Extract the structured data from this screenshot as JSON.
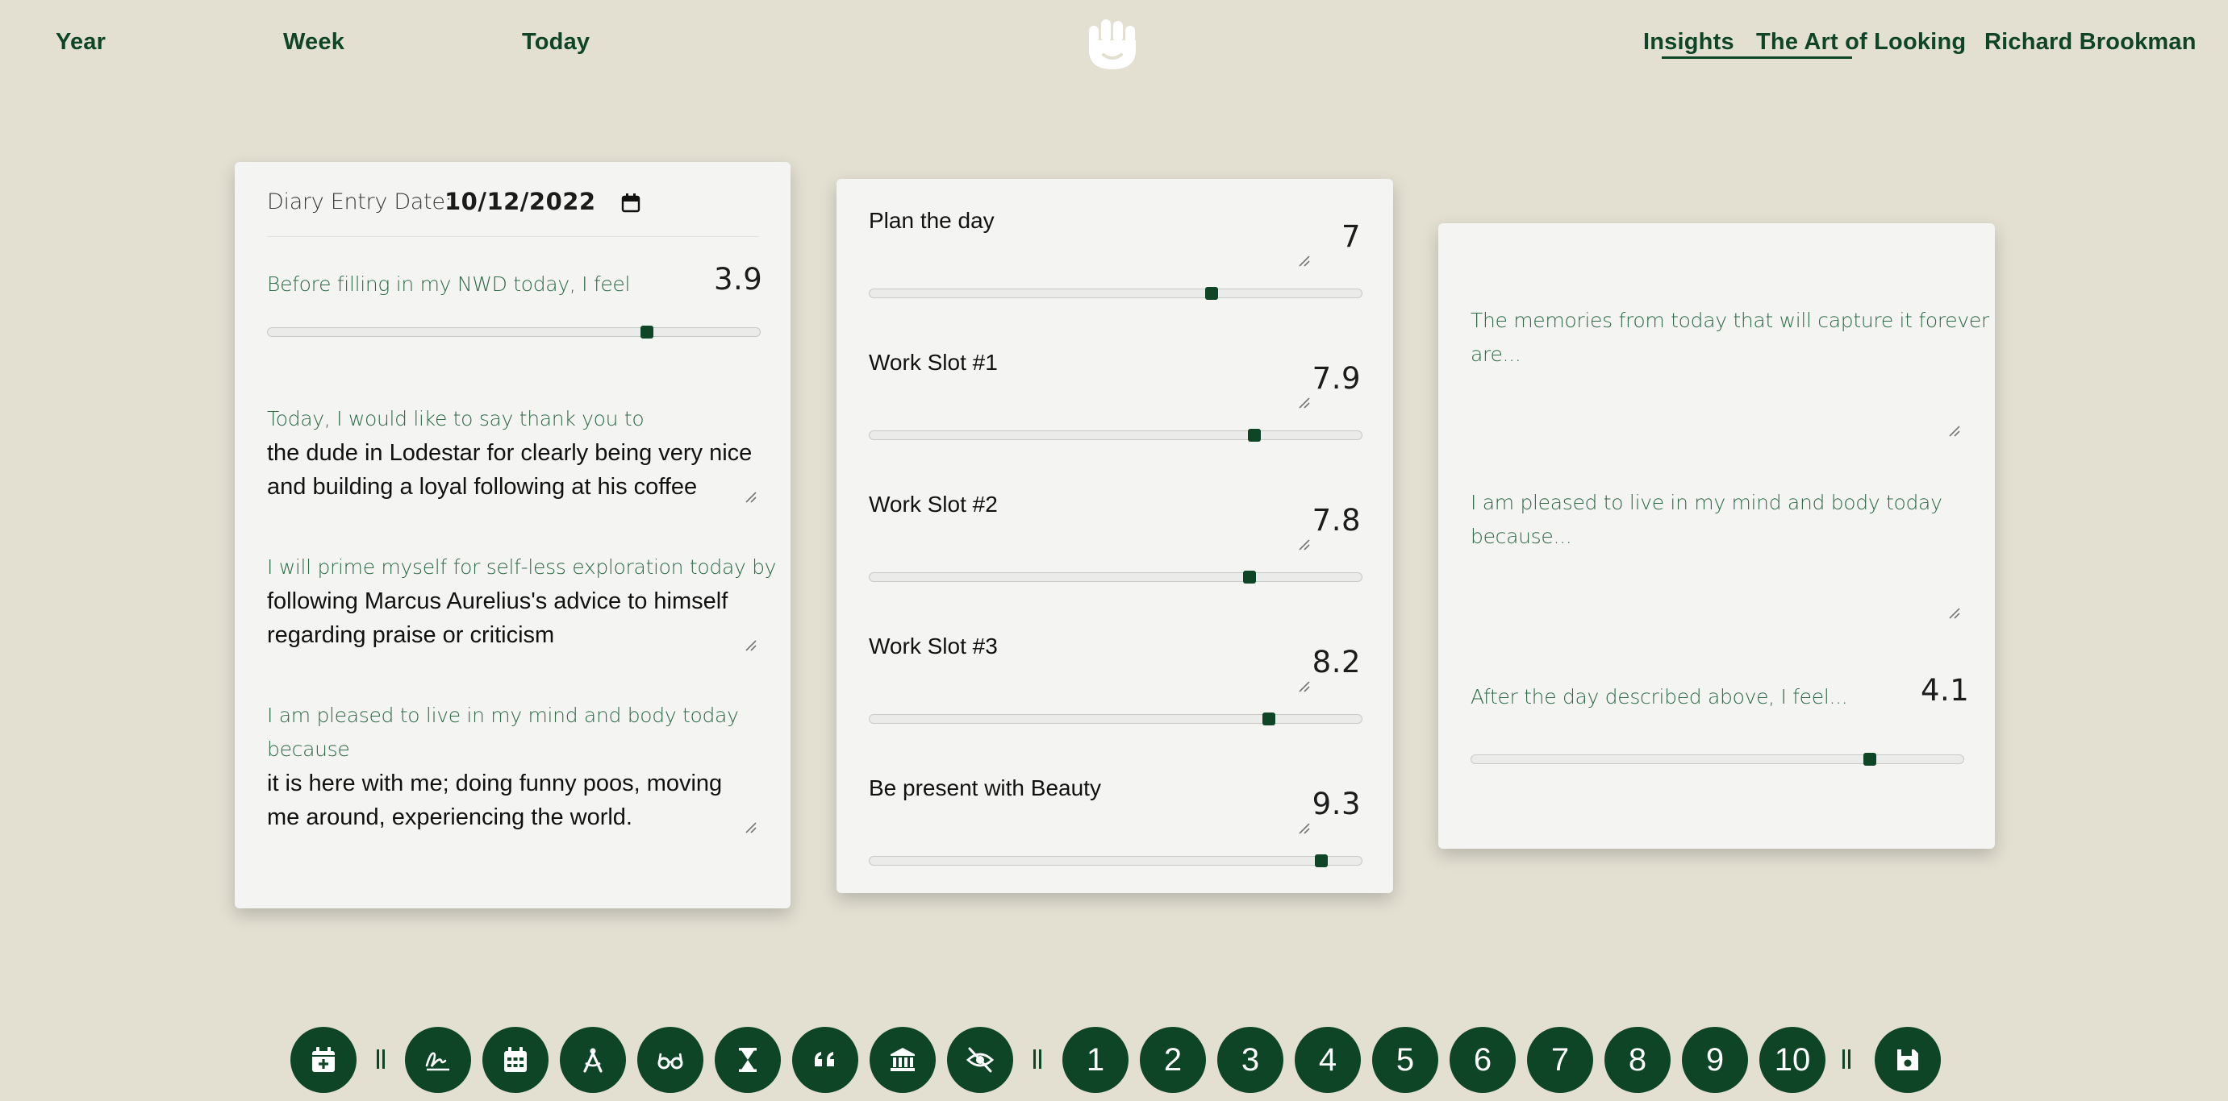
{
  "nav": {
    "year": "Year",
    "week": "Week",
    "today": "Today",
    "insights": "Insights",
    "art_of_looking": "The Art of Looking",
    "user": "Richard Brookman",
    "logo": "hand-crown-logo"
  },
  "left_card": {
    "date_label": "Diary Entry Date:",
    "date_value": "10/12/2022",
    "before_label": "Before filling in my NWD today, I feel",
    "before_score": "3.9",
    "before_level": 0.77,
    "thanks_label": "Today, I would like to say thank you to",
    "thanks_line1": "the dude in Lodestar for clearly being very nice",
    "thanks_line2": "and building a loyal following at his coffee",
    "prime_label": "I will prime myself for self-less exploration today by",
    "prime_line1": "following Marcus Aurelius's advice to himself",
    "prime_line2": "regarding praise or criticism",
    "pleased_label_line1": "I am pleased to live in my mind and body today",
    "pleased_label_line2": "because",
    "pleased_line1": "it is here with me; doing funny poos, moving",
    "pleased_line2": "me around, experiencing the world."
  },
  "middle_card": {
    "slots": [
      {
        "title": "Plan the day",
        "score": "7",
        "level": 0.695
      },
      {
        "title": "Work Slot #1",
        "score": "7.9",
        "level": 0.782
      },
      {
        "title": "Work Slot #2",
        "score": "7.8",
        "level": 0.772
      },
      {
        "title": "Work Slot #3",
        "score": "8.2",
        "level": 0.811
      },
      {
        "title": "Be present with Beauty",
        "score": "9.3",
        "level": 0.918
      }
    ]
  },
  "right_card": {
    "memories_line1": "The memories from today that will capture it forever",
    "memories_line2": "are...",
    "pleased_line1": "I am pleased to live in my mind and body today",
    "pleased_line2": "because...",
    "after_label": "After the day described above, I feel...",
    "after_score": "4.1",
    "after_level": 0.81
  },
  "toolbar": {
    "numbers": [
      "1",
      "2",
      "3",
      "4",
      "5",
      "6",
      "7",
      "8",
      "9",
      "10"
    ],
    "icons": [
      "calendar-plus-icon",
      "signature-icon",
      "calendar-icon",
      "compass-drafting-icon",
      "glasses-icon",
      "hourglass-icon",
      "quote-icon",
      "landmark-icon",
      "eye-slash-icon",
      "save-icon"
    ]
  },
  "colors": {
    "background": "#e3e0d2",
    "accent": "#0f4527",
    "label_green": "#2d6a45",
    "card": "#f4f4f3"
  }
}
